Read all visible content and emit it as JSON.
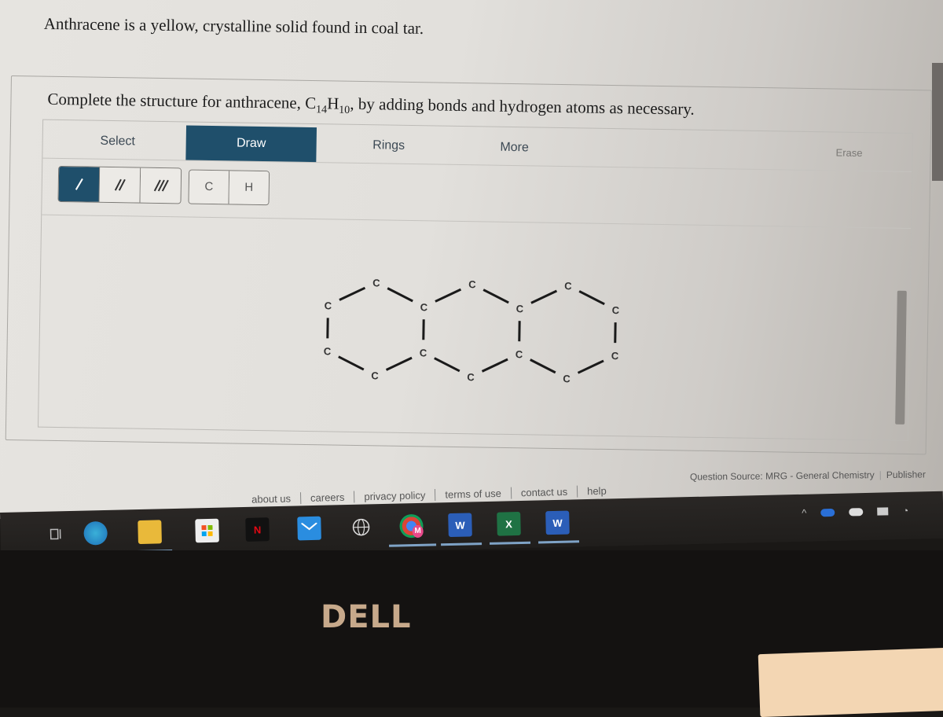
{
  "question": {
    "intro": "Anthracene is a yellow, crystalline solid found in coal tar.",
    "prompt_before": "Complete the structure for anthracene, C",
    "formula_c_sub": "14",
    "formula_h": "H",
    "formula_h_sub": "10",
    "prompt_after": ", by adding bonds and hydrogen atoms as necessary."
  },
  "editor": {
    "tabs": [
      {
        "label": "Select",
        "active": false
      },
      {
        "label": "Draw",
        "active": true
      },
      {
        "label": "Rings",
        "active": false
      },
      {
        "label": "More",
        "active": false
      }
    ],
    "erase_label": "Erase",
    "bond_tools": [
      {
        "name": "single-bond",
        "active": true
      },
      {
        "name": "double-bond",
        "active": false
      },
      {
        "name": "triple-bond",
        "active": false
      }
    ],
    "atom_tools": [
      "C",
      "H"
    ],
    "molecule": {
      "atom_label": "C",
      "atom_count": 14
    }
  },
  "source": {
    "text": "Question Source: MRG - General Chemistry",
    "publisher": "Publisher"
  },
  "footer_links": [
    "about us",
    "careers",
    "privacy policy",
    "terms of use",
    "contact us",
    "help"
  ],
  "taskbar": {
    "apps": [
      {
        "name": "task-view",
        "label": ""
      },
      {
        "name": "edge",
        "label": ""
      },
      {
        "name": "file-explorer",
        "label": ""
      },
      {
        "name": "microsoft-store",
        "label": ""
      },
      {
        "name": "netflix",
        "label": "N"
      },
      {
        "name": "mail",
        "label": ""
      },
      {
        "name": "browser-globe",
        "label": ""
      },
      {
        "name": "chrome",
        "label": "M"
      },
      {
        "name": "word",
        "label": "W"
      },
      {
        "name": "excel",
        "label": "X"
      },
      {
        "name": "word-2",
        "label": "W"
      }
    ]
  },
  "laptop_brand": "DELL"
}
